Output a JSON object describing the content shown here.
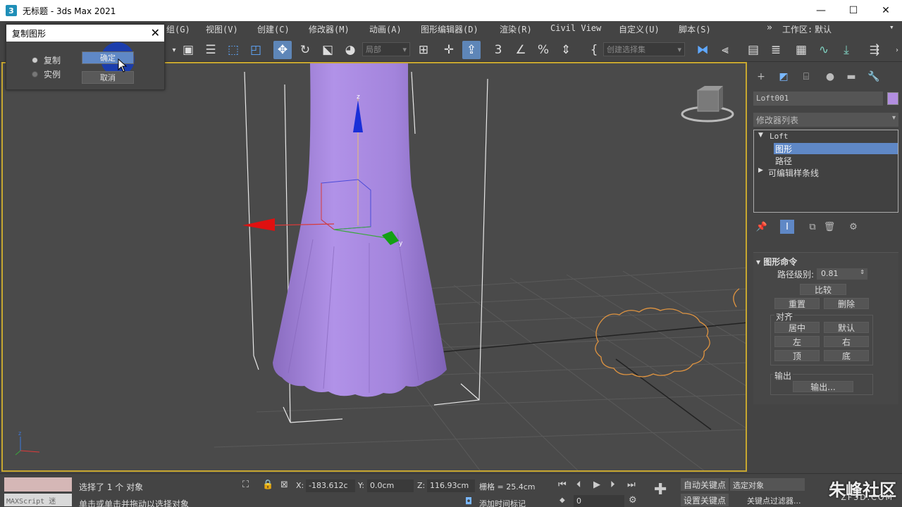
{
  "window": {
    "title": "无标题 - 3ds Max 2021",
    "app_icon": "3",
    "minimize": "—",
    "maximize": "☐",
    "close": "✕"
  },
  "menu": {
    "items": [
      "组(G)",
      "视图(V)",
      "创建(C)",
      "修改器(M)",
      "动画(A)",
      "图形编辑器(D)",
      "渲染(R)",
      "Civil View",
      "自定义(U)",
      "脚本(S)"
    ],
    "more": "»",
    "workspace_label": "工作区:",
    "workspace_value": "默认"
  },
  "toolbar": {
    "coord_system": "局部",
    "named_selection": "创建选择集"
  },
  "dialog": {
    "title": "复制图形",
    "close": "✕",
    "option_copy": "复制",
    "option_instance": "实例",
    "ok": "确定",
    "cancel": "取消"
  },
  "panel": {
    "object_name": "Loft001",
    "object_color": "#b28ee0",
    "modifier_list": "修改器列表",
    "stack": {
      "loft": "Loft",
      "shape": "图形",
      "path": "路径",
      "editable_spline": "可编辑样条线"
    },
    "rollout": {
      "title": "图形命令",
      "path_level_label": "路径级别:",
      "path_level_value": "0.81",
      "compare": "比较",
      "reset": "重置",
      "delete": "删除",
      "align_label": "对齐",
      "center": "居中",
      "default": "默认",
      "left": "左",
      "right": "右",
      "top": "顶",
      "bottom": "底",
      "output_label": "输出",
      "output": "输出..."
    }
  },
  "status": {
    "selected": "选择了 1 个 对象",
    "prompt": "单击或单击并拖动以选择对象",
    "maxscript": "MAXScript 迷",
    "x_label": "X:",
    "x_value": "-183.612c",
    "y_label": "Y:",
    "y_value": "0.0cm",
    "z_label": "Z:",
    "z_value": "116.93cm",
    "grid": "栅格 = 25.4cm",
    "add_time_tag": "添加时间标记",
    "auto_key": "自动关键点",
    "set_key": "设置关键点",
    "selected_object": "选定对象",
    "key_filters": "关键点过滤器...",
    "frame": "0"
  },
  "watermark": {
    "brand": "朱峰社区",
    "url": "ZF3D.COM"
  },
  "colors": {
    "viewport_border": "#c7a730",
    "selection": "#5f88c6",
    "object": "#a98ad8"
  }
}
